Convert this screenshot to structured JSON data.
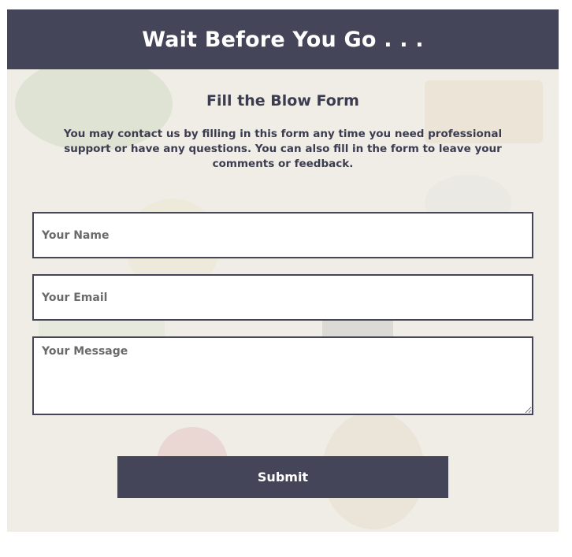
{
  "header": {
    "title": "Wait Before You Go . . ."
  },
  "form": {
    "subtitle": "Fill the Blow Form",
    "intro": "You may contact us by filling in this form any time you need professional support or have any questions. You can also fill in the form to leave your comments or feedback.",
    "name_placeholder": "Your Name",
    "email_placeholder": "Your Email",
    "message_placeholder": "Your Message",
    "submit_label": "Submit"
  },
  "colors": {
    "primary": "#45455a",
    "text": "#3c3c50",
    "background": "#ece9e2"
  }
}
